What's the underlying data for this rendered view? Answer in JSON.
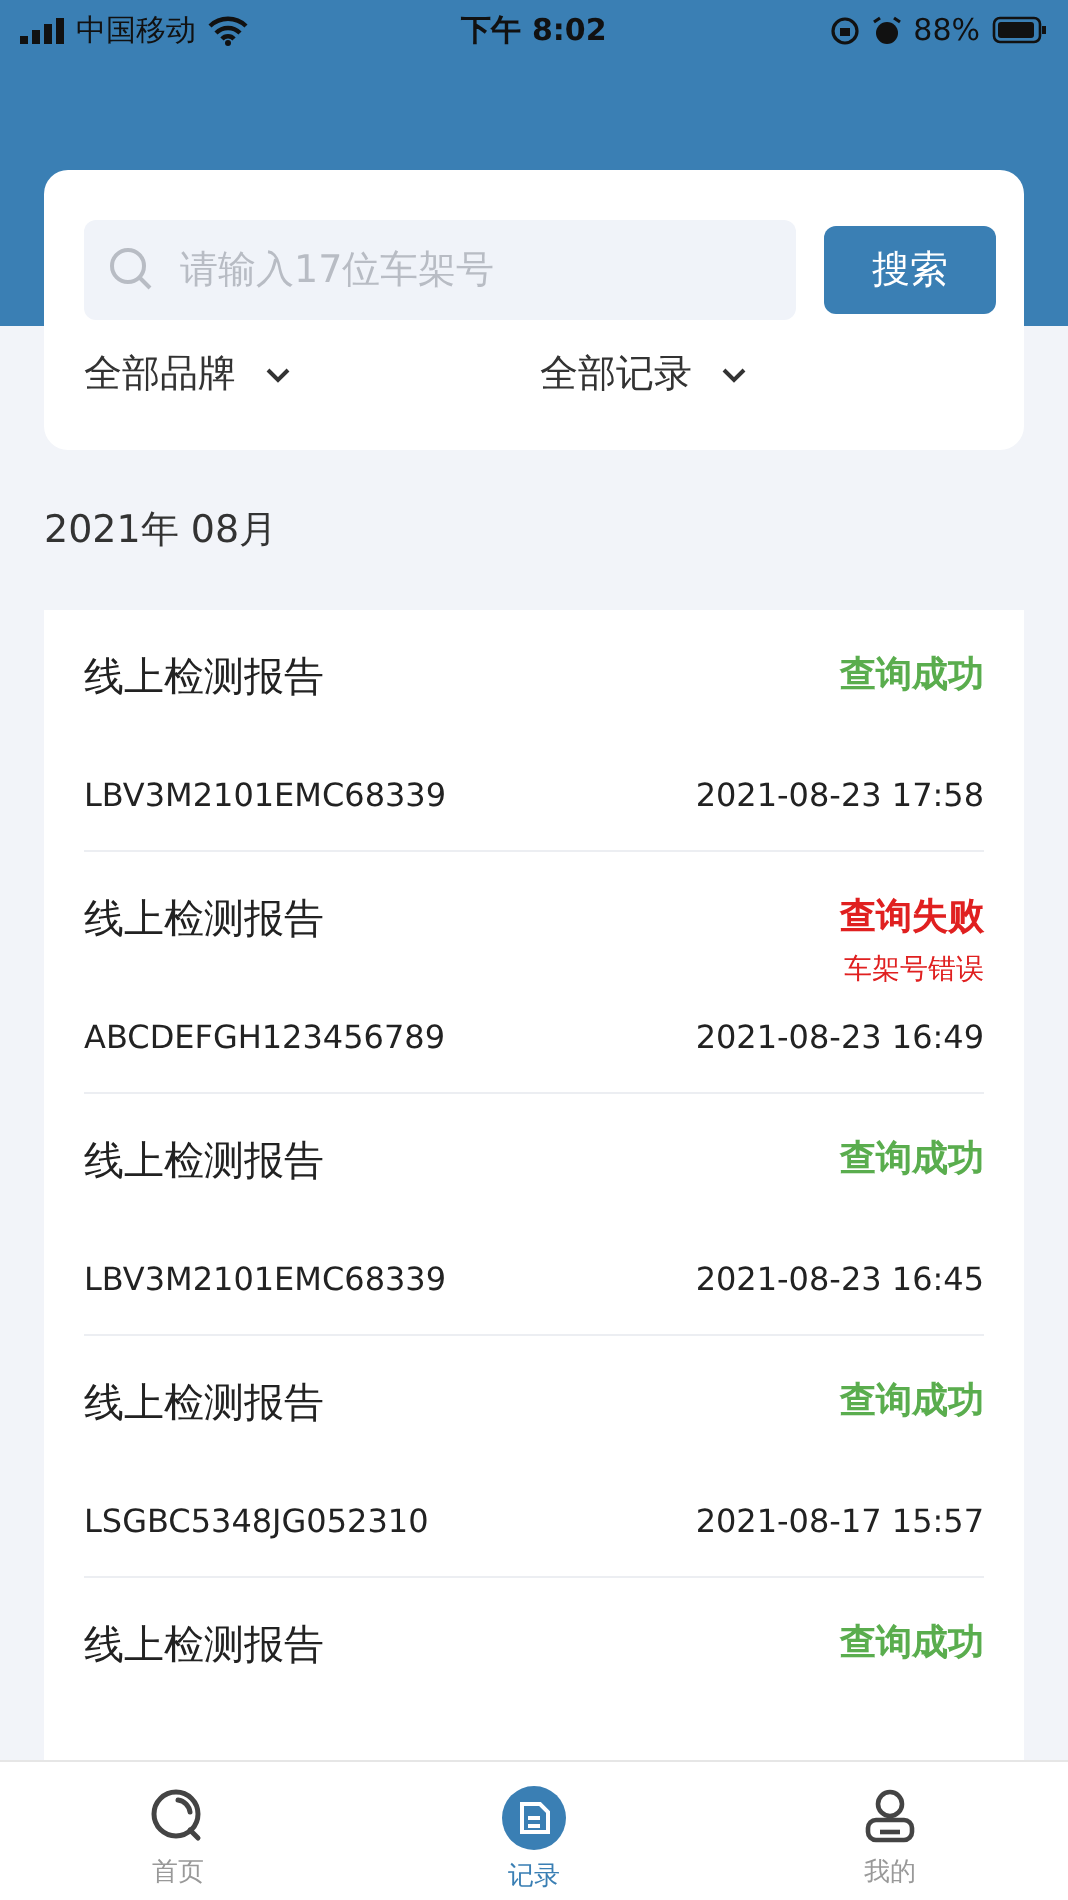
{
  "status_bar": {
    "carrier": "中国移动",
    "time": "下午 8:02",
    "battery": "88%"
  },
  "search": {
    "placeholder": "请输入17位车架号",
    "button": "搜索"
  },
  "filters": [
    {
      "label": "全部品牌"
    },
    {
      "label": "全部记录"
    }
  ],
  "month": "2021年 08月",
  "records": [
    {
      "title": "线上检测报告",
      "status": {
        "kind": "success",
        "label": "查询成功"
      },
      "vin": "LBV3M2101EMC68339",
      "time": "2021-08-23 17:58"
    },
    {
      "title": "线上检测报告",
      "status": {
        "kind": "failure",
        "label": "查询失败",
        "reason": "车架号错误"
      },
      "vin": "ABCDEFGH123456789",
      "time": "2021-08-23 16:49"
    },
    {
      "title": "线上检测报告",
      "status": {
        "kind": "success",
        "label": "查询成功"
      },
      "vin": "LBV3M2101EMC68339",
      "time": "2021-08-23 16:45"
    },
    {
      "title": "线上检测报告",
      "status": {
        "kind": "success",
        "label": "查询成功"
      },
      "vin": "LSGBC5348JG052310",
      "time": "2021-08-17 15:57"
    },
    {
      "title": "线上检测报告",
      "status": {
        "kind": "success",
        "label": "查询成功"
      }
    }
  ],
  "tabs": [
    {
      "kind": "home",
      "label": "首页",
      "selected": false
    },
    {
      "kind": "records",
      "label": "记录",
      "selected": true
    },
    {
      "kind": "profile",
      "label": "我的",
      "selected": false
    }
  ]
}
